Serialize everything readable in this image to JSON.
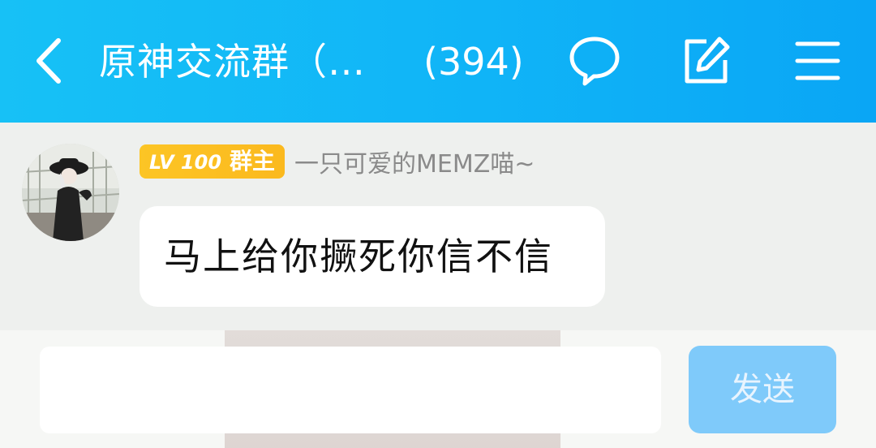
{
  "header": {
    "title": "原神交流群（…",
    "member_count": "(394)",
    "icons": [
      "back-chevron-icon",
      "chat-bubble-icon",
      "edit-icon",
      "menu-icon"
    ]
  },
  "message": {
    "badge_level": "LV 100",
    "badge_role": "群主",
    "sender": "一只可爱的MEMZ喵~",
    "text": "马上给你撅死你信不信"
  },
  "composer": {
    "input_value": "",
    "send_label": "发送"
  },
  "colors": {
    "header_bg": "#10b4f7",
    "badge_bg": "#fcc525",
    "send_bg": "#7fcafa",
    "chat_bg": "#eef0ee"
  }
}
